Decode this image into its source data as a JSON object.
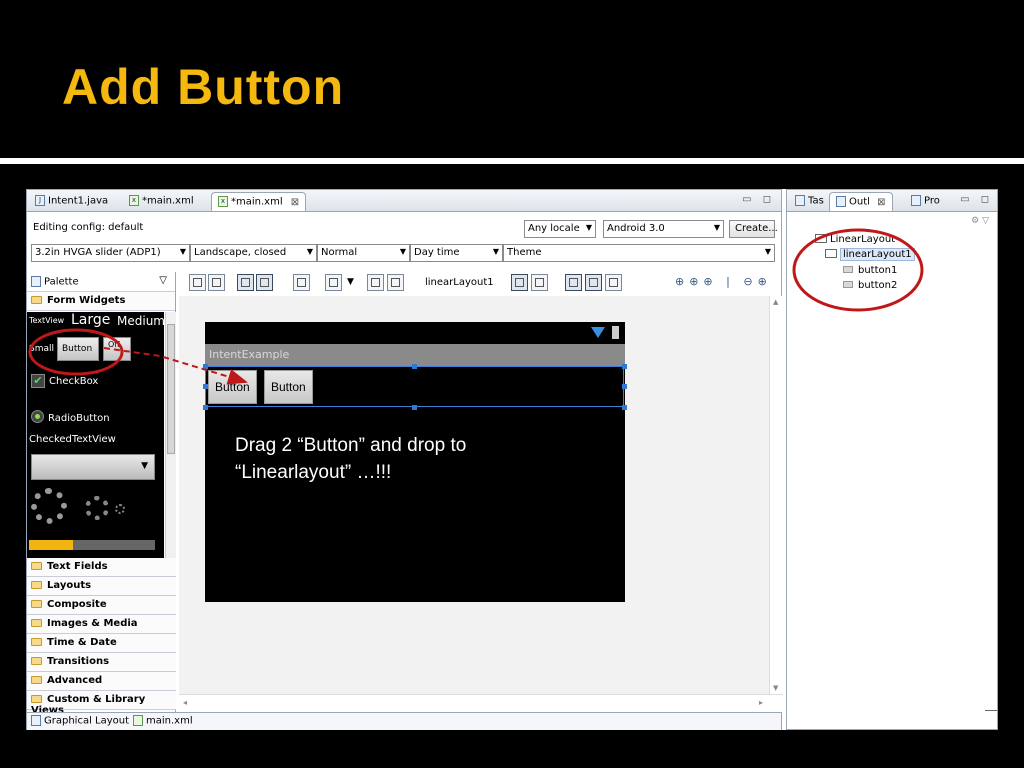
{
  "slide": {
    "title": "Add Button"
  },
  "colors": {
    "title": "#f5b80f",
    "annotation_red": "#c01818",
    "selection_blue": "#2f79d4",
    "background": "#000000"
  },
  "editor": {
    "tabs": [
      {
        "label": "Intent1.java",
        "icon": "java-file-icon"
      },
      {
        "label": "*main.xml",
        "icon": "xml-file-icon"
      },
      {
        "label": "*main.xml",
        "icon": "xml-file-icon",
        "active": true,
        "close": "⊠"
      }
    ],
    "window_controls": "▭ ◻",
    "config": {
      "editing_label": "Editing config: default",
      "locale": "Any locale",
      "api": "Android 3.0",
      "create_button": "Create..."
    },
    "device_bar": {
      "device": "3.2in HVGA slider (ADP1)",
      "orientation": "Landscape, closed",
      "density": "Normal",
      "time": "Day time",
      "theme": "Theme"
    },
    "toolbar": {
      "layout_name": "linearLayout1"
    },
    "bottom_tabs": [
      {
        "label": "Graphical Layout",
        "icon": "layout-icon"
      },
      {
        "label": "main.xml",
        "icon": "xml-file-icon"
      }
    ]
  },
  "palette": {
    "title": "Palette",
    "open_category": "Form Widgets",
    "widgets": {
      "textview": "TextView",
      "large": "Large",
      "medium": "Medium",
      "small": "Small",
      "button": "Button",
      "toggle": "Off",
      "checkbox": "CheckBox",
      "radio": "RadioButton",
      "checked_text": "CheckedTextView",
      "progress": 0.35
    },
    "categories": [
      "Text Fields",
      "Layouts",
      "Composite",
      "Images & Media",
      "Time & Date",
      "Transitions",
      "Advanced",
      "Custom & Library Views"
    ]
  },
  "device": {
    "app_title": "IntentExample",
    "buttons": [
      "Button",
      "Button"
    ],
    "note_line1": "Drag 2 “Button” and drop to",
    "note_line2": "“Linearlayout” …!!!"
  },
  "outline": {
    "tabs": [
      {
        "label": "Tas",
        "icon": "tasks-icon"
      },
      {
        "label": "Outl",
        "icon": "outline-icon",
        "active": true,
        "close": "⊠"
      },
      {
        "label": "Pro",
        "icon": "properties-icon"
      }
    ],
    "tree": [
      {
        "label": "LinearLayout",
        "level": 0
      },
      {
        "label": "linearLayout1",
        "level": 1
      },
      {
        "label": "button1",
        "level": 2
      },
      {
        "label": "button2",
        "level": 2
      }
    ]
  }
}
